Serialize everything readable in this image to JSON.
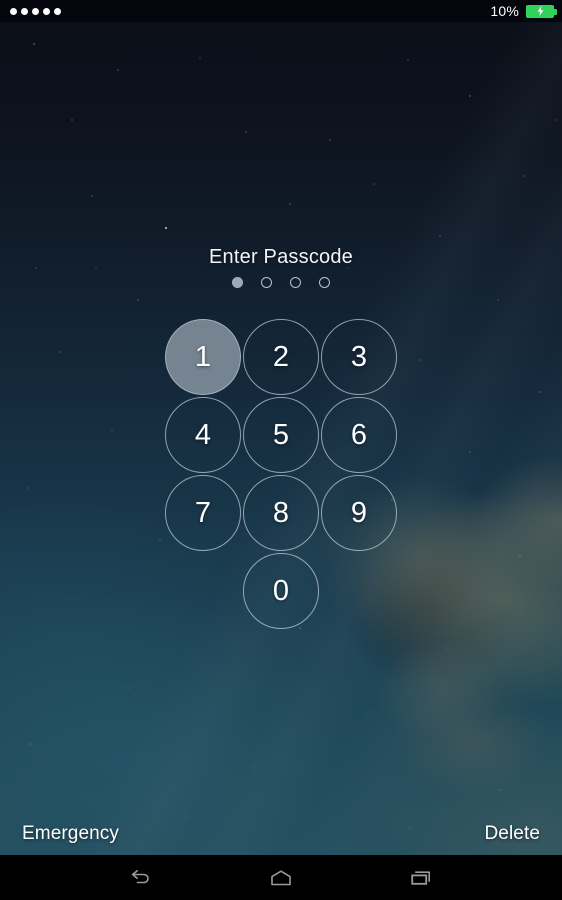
{
  "status_bar": {
    "notification_dots": 5,
    "battery_percent": "10%",
    "battery_icon": "battery-charging-icon",
    "battery_color": "#30d158",
    "charging": true
  },
  "lock_screen": {
    "title": "Enter Passcode",
    "passcode_length": 4,
    "entered_digits": 1,
    "dots": [
      {
        "filled": true
      },
      {
        "filled": false
      },
      {
        "filled": false
      },
      {
        "filled": false
      }
    ],
    "keypad": [
      {
        "label": "1",
        "pressed": true
      },
      {
        "label": "2",
        "pressed": false
      },
      {
        "label": "3",
        "pressed": false
      },
      {
        "label": "4",
        "pressed": false
      },
      {
        "label": "5",
        "pressed": false
      },
      {
        "label": "6",
        "pressed": false
      },
      {
        "label": "7",
        "pressed": false
      },
      {
        "label": "8",
        "pressed": false
      },
      {
        "label": "9",
        "pressed": false
      },
      {
        "label": "0",
        "pressed": false
      }
    ],
    "emergency_label": "Emergency",
    "delete_label": "Delete",
    "accent_text_color": "#ffffff",
    "pressed_key_color": "#bec8d2"
  },
  "nav_bar": {
    "background": "#000000",
    "icon_color": "#9a9a9a",
    "buttons": [
      {
        "name": "back-icon"
      },
      {
        "name": "home-icon"
      },
      {
        "name": "recents-icon"
      }
    ]
  },
  "wallpaper": {
    "description": "starry night sky with nebula",
    "top_color": "#0b0e16",
    "bottom_color": "#244f5e"
  }
}
